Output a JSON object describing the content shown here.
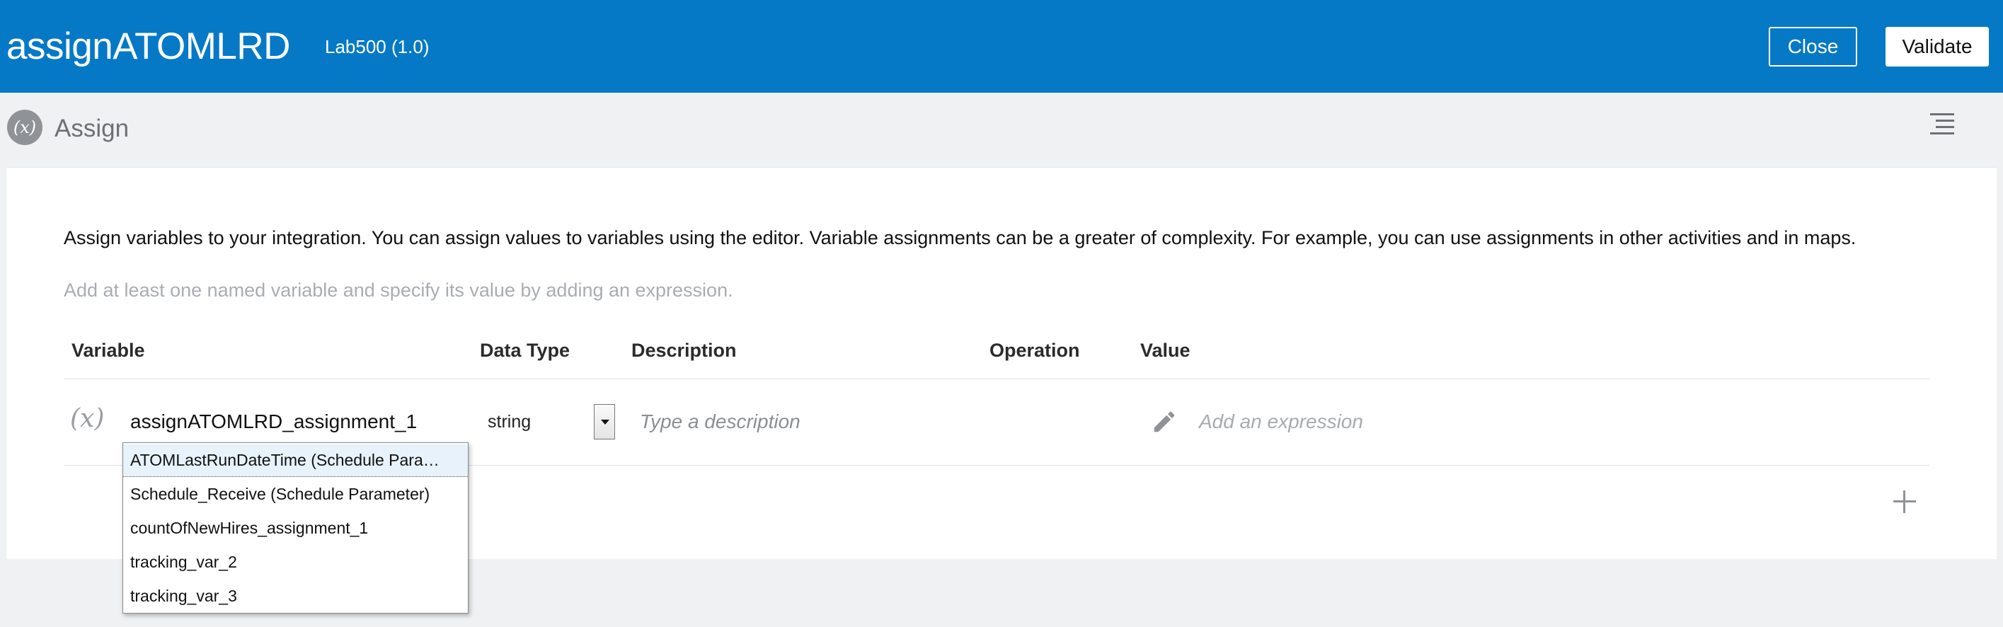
{
  "header": {
    "title": "assignATOMLRD",
    "subtitle": "Lab500 (1.0)",
    "close_label": "Close",
    "validate_label": "Validate",
    "brand_color": "#0679c6"
  },
  "subheader": {
    "icon_label": "(x)",
    "title": "Assign"
  },
  "main": {
    "intro": "Assign variables to your integration. You can assign values to variables using the editor. Variable assignments can be a greater of complexity. For example, you can use assignments in other activities and in maps.",
    "hint": "Add at least one named variable and specify its value by adding an expression.",
    "columns": [
      "Variable",
      "Data Type",
      "Description",
      "Operation",
      "Value"
    ],
    "row": {
      "icon_label": "(x)",
      "variable": "assignATOMLRD_assignment_1",
      "data_type": "string",
      "description_value": "",
      "description_placeholder": "Type a description",
      "value_placeholder": "Add an expression"
    }
  },
  "dropdown": {
    "items": [
      "ATOMLastRunDateTime (Schedule Para…",
      "Schedule_Receive (Schedule Parameter)",
      "countOfNewHires_assignment_1",
      "tracking_var_2",
      "tracking_var_3"
    ],
    "selected_index": 0
  },
  "icons": [
    "variable-x-icon",
    "menu-lines-icon",
    "dropdown-arrow-icon",
    "pencil-icon",
    "plus-icon"
  ]
}
